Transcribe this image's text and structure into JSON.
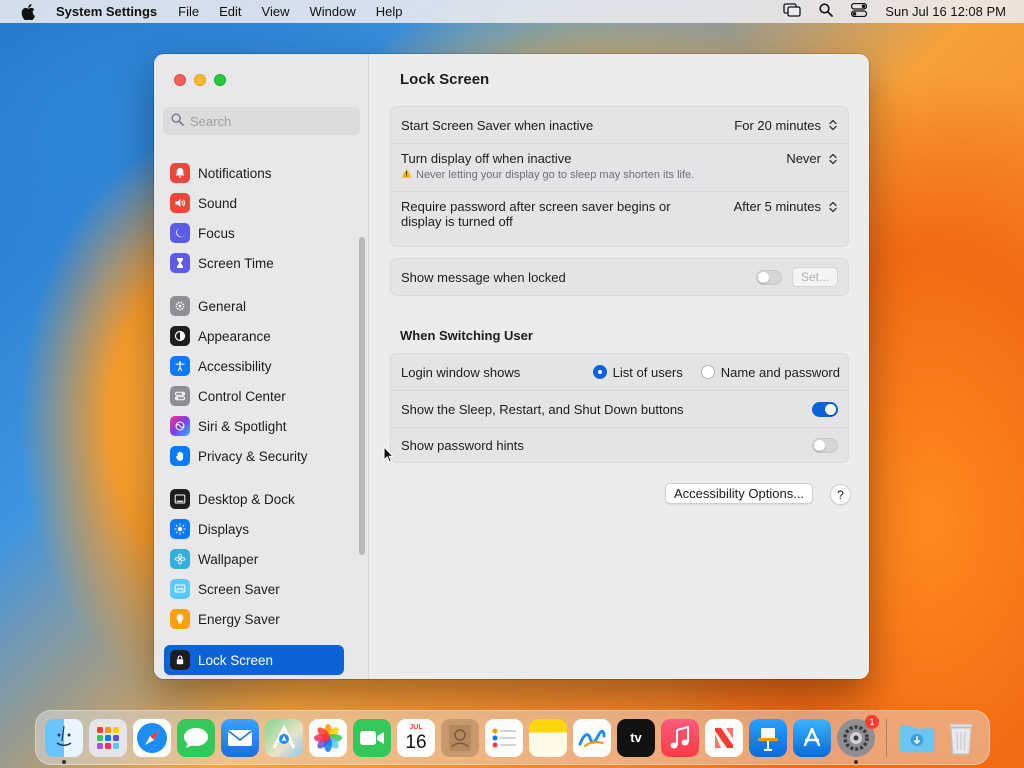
{
  "menubar": {
    "app_name": "System Settings",
    "menus": [
      "File",
      "Edit",
      "View",
      "Window",
      "Help"
    ],
    "clock": "Sun Jul 16  12:08 PM"
  },
  "sidebar": {
    "search_placeholder": "Search",
    "items": [
      {
        "label": "Notifications",
        "icon": "bell-icon",
        "color": "#f0453a"
      },
      {
        "label": "Sound",
        "icon": "speaker-icon",
        "color": "#f0453a"
      },
      {
        "label": "Focus",
        "icon": "moon-icon",
        "color": "#5e5ce6"
      },
      {
        "label": "Screen Time",
        "icon": "hourglass-icon",
        "color": "#5e5ce6"
      },
      {
        "label": "General",
        "icon": "gear-icon",
        "color": "#8e8e93"
      },
      {
        "label": "Appearance",
        "icon": "appearance-icon",
        "color": "#1d1d1f"
      },
      {
        "label": "Accessibility",
        "icon": "accessibility-icon",
        "color": "#0a7aff"
      },
      {
        "label": "Control Center",
        "icon": "control-center-icon",
        "color": "#8e8e93"
      },
      {
        "label": "Siri & Spotlight",
        "icon": "siri-icon",
        "color": "#7b3fe4"
      },
      {
        "label": "Privacy & Security",
        "icon": "hand-icon",
        "color": "#0a7aff"
      },
      {
        "label": "Desktop & Dock",
        "icon": "dock-icon",
        "color": "#1d1d1f"
      },
      {
        "label": "Displays",
        "icon": "sun-icon",
        "color": "#0a7aff"
      },
      {
        "label": "Wallpaper",
        "icon": "flower-icon",
        "color": "#35aee0"
      },
      {
        "label": "Screen Saver",
        "icon": "screen-saver-icon",
        "color": "#5ac8fa"
      },
      {
        "label": "Energy Saver",
        "icon": "bulb-icon",
        "color": "#ff9f0a"
      },
      {
        "label": "Lock Screen",
        "icon": "lock-icon",
        "color": "#1d1d1f"
      }
    ]
  },
  "content": {
    "title": "Lock Screen",
    "screen_saver": {
      "label": "Start Screen Saver when inactive",
      "value": "For 20 minutes"
    },
    "display_off": {
      "label": "Turn display off when inactive",
      "value": "Never",
      "warning": "Never letting your display go to sleep may shorten its life."
    },
    "require_password": {
      "label_line1": "Require password after screen saver begins or",
      "label_line2": "display is turned off",
      "value": "After 5 minutes"
    },
    "show_message": {
      "label": "Show message when locked",
      "button": "Set..."
    },
    "switching_title": "When Switching User",
    "login_window": {
      "label": "Login window shows",
      "option1": "List of users",
      "option2": "Name and password",
      "selected": "List of users"
    },
    "sleep_buttons": {
      "label": "Show the Sleep, Restart, and Shut Down buttons"
    },
    "password_hints": {
      "label": "Show password hints"
    },
    "accessibility_button": "Accessibility Options...",
    "help_button": "?"
  },
  "dock": {
    "apps": [
      {
        "name": "Finder",
        "icon": "finder-icon",
        "color": "#1e90ff"
      },
      {
        "name": "Launchpad",
        "icon": "launchpad-icon",
        "color": "#e5e5ea"
      },
      {
        "name": "Safari",
        "icon": "safari-icon",
        "color": "#1c8ef9"
      },
      {
        "name": "Messages",
        "icon": "messages-icon",
        "color": "#34c759"
      },
      {
        "name": "Mail",
        "icon": "mail-icon",
        "color": "#1a8cff"
      },
      {
        "name": "Maps",
        "icon": "maps-icon",
        "color": "#5ac86a"
      },
      {
        "name": "Photos",
        "icon": "photos-icon",
        "color": "#ffffff"
      },
      {
        "name": "FaceTime",
        "icon": "facetime-icon",
        "color": "#34c759"
      },
      {
        "name": "Calendar",
        "icon": "calendar-icon",
        "color": "#ffffff",
        "month": "JUL",
        "day": "16"
      },
      {
        "name": "Contacts",
        "icon": "contacts-icon",
        "color": "#c69a6d"
      },
      {
        "name": "Reminders",
        "icon": "reminders-icon",
        "color": "#ffffff"
      },
      {
        "name": "Notes",
        "icon": "notes-icon",
        "color": "#ffd60a"
      },
      {
        "name": "Freeform",
        "icon": "freeform-icon",
        "color": "#ffffff"
      },
      {
        "name": "TV",
        "icon": "tv-icon",
        "color": "#111111",
        "glyph": "tv"
      },
      {
        "name": "Music",
        "icon": "music-icon",
        "color": "#fc3c44"
      },
      {
        "name": "News",
        "icon": "news-icon",
        "color": "#ffffff"
      },
      {
        "name": "Keynote",
        "icon": "keynote-icon",
        "color": "#1c8ef9"
      },
      {
        "name": "App Store",
        "icon": "app-store-icon",
        "color": "#1c8ef9"
      },
      {
        "name": "System Settings",
        "icon": "system-settings-icon",
        "color": "#8e8e93",
        "badge": "1"
      }
    ]
  }
}
